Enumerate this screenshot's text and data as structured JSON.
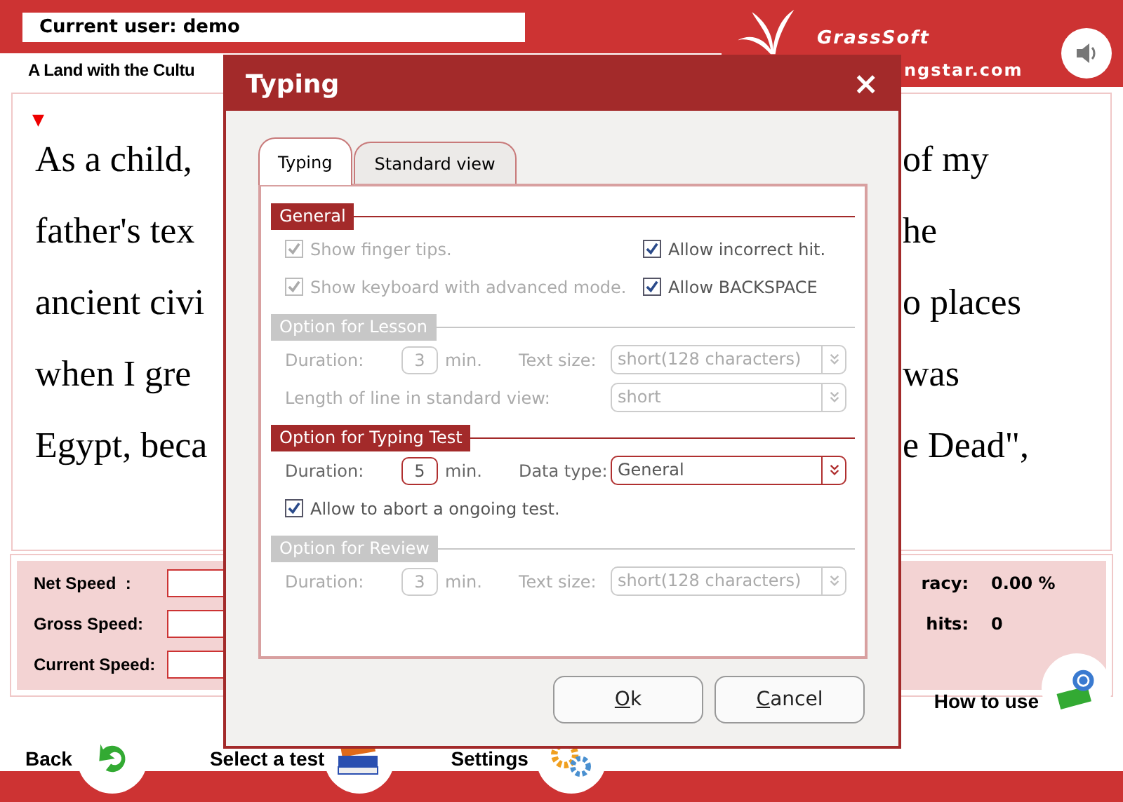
{
  "header": {
    "user_label": "Current user: demo",
    "brand": "GrassSoft",
    "site": "ngstar.com"
  },
  "lesson_title": "A Land with the Cultu",
  "marker": "▼",
  "text_lines": [
    {
      "left": "As a child,",
      "right": "of my"
    },
    {
      "left": "father's tex",
      "right": "he"
    },
    {
      "left": "ancient civi",
      "right": "o places"
    },
    {
      "left": "when I gre",
      "right": "was"
    },
    {
      "left": "Egypt, beca",
      "right": "e Dead\","
    }
  ],
  "stats_left": [
    {
      "label": "Net Speed  :"
    },
    {
      "label": "Gross Speed:"
    },
    {
      "label": "Current Speed:"
    }
  ],
  "stats_right": [
    {
      "label": "racy:",
      "value": "0.00 %"
    },
    {
      "label": "hits:",
      "value": "0"
    }
  ],
  "nav": [
    {
      "label": "Back"
    },
    {
      "label": "Select a test"
    },
    {
      "label": "Settings"
    },
    {
      "label": "How to use"
    }
  ],
  "dialog": {
    "title": "Typing",
    "close": "×",
    "tabs": [
      {
        "label": "Typing",
        "selected": true
      },
      {
        "label": "Standard view",
        "selected": false
      }
    ],
    "sections": [
      {
        "title": "General",
        "disabled": false,
        "rows": [
          {
            "items": [
              {
                "kind": "checkbox",
                "label": "Show finger tips.",
                "checked": true,
                "disabled": true
              },
              {
                "kind": "checkbox",
                "label": "Allow incorrect hit.",
                "checked": true,
                "disabled": false
              }
            ]
          },
          {
            "items": [
              {
                "kind": "checkbox",
                "label": "Show keyboard with advanced mode.",
                "checked": true,
                "disabled": true
              },
              {
                "kind": "checkbox",
                "label": "Allow BACKSPACE",
                "checked": true,
                "disabled": false
              }
            ]
          }
        ]
      },
      {
        "title": "Option for Lesson",
        "disabled": true,
        "rows": [
          {
            "items": [
              {
                "kind": "duration",
                "label": "Duration:",
                "value": "3",
                "unit": "min."
              },
              {
                "kind": "select",
                "label": "Text size:",
                "value": "short(128 characters)"
              }
            ]
          },
          {
            "items": [
              {
                "kind": "select",
                "label": "Length of line in standard view:",
                "value": "short"
              }
            ]
          }
        ]
      },
      {
        "title": "Option for Typing Test",
        "disabled": false,
        "rows": [
          {
            "items": [
              {
                "kind": "duration",
                "label": "Duration:",
                "value": "5",
                "unit": "min."
              },
              {
                "kind": "select",
                "label": "Data type:",
                "value": "General"
              }
            ]
          },
          {
            "items": [
              {
                "kind": "checkbox",
                "label": "Allow to abort a ongoing test.",
                "checked": true,
                "disabled": false
              }
            ]
          }
        ]
      },
      {
        "title": "Option for Review",
        "disabled": true,
        "rows": [
          {
            "items": [
              {
                "kind": "duration",
                "label": "Duration:",
                "value": "3",
                "unit": "min."
              },
              {
                "kind": "select",
                "label": "Text size:",
                "value": "short(128 characters)"
              }
            ]
          }
        ]
      }
    ],
    "buttons": [
      {
        "label": "Ok"
      },
      {
        "label": "Cancel"
      }
    ]
  }
}
